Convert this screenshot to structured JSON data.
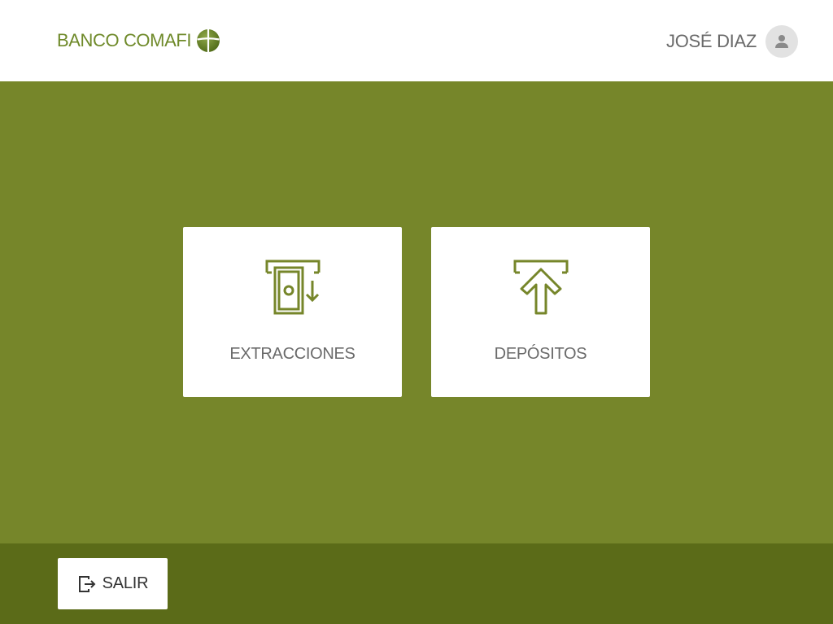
{
  "header": {
    "brand_name": "BANCO COMAFI",
    "brand_logo_icon": "globe-logo",
    "user_name": "JOSÉ DIAZ",
    "avatar_icon": "person-icon"
  },
  "actions": [
    {
      "label": "EXTRACCIONES",
      "icon": "cash-withdrawal-icon"
    },
    {
      "label": "DEPÓSITOS",
      "icon": "deposit-arrow-up-icon"
    }
  ],
  "footer": {
    "exit_label": "SALIR",
    "exit_icon": "logout-icon"
  },
  "colors": {
    "brand_green": "#6f8a2a",
    "main_background": "#76862a",
    "footer_background": "#5b6b18",
    "icon_green": "#76862a",
    "text_gray": "#6a6a6a"
  }
}
